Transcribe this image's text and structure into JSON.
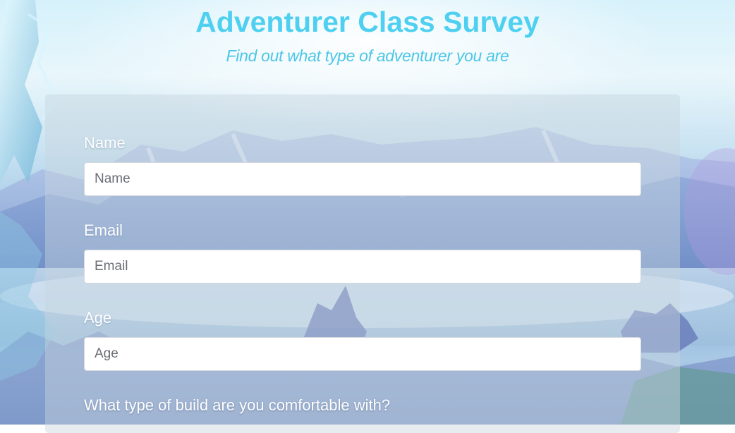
{
  "header": {
    "title": "Adventurer Class Survey",
    "subtitle": "Find out what type of adventurer you are"
  },
  "form": {
    "name": {
      "label": "Name",
      "placeholder": "Name",
      "value": ""
    },
    "email": {
      "label": "Email",
      "placeholder": "Email",
      "value": ""
    },
    "age": {
      "label": "Age",
      "placeholder": "Age",
      "value": ""
    },
    "build_question": "What type of build are you comfortable with?"
  },
  "colors": {
    "title": "#4fd0f0",
    "subtitle": "#4cc6e6",
    "label": "#ffffff",
    "panel": "#c8d4de"
  }
}
